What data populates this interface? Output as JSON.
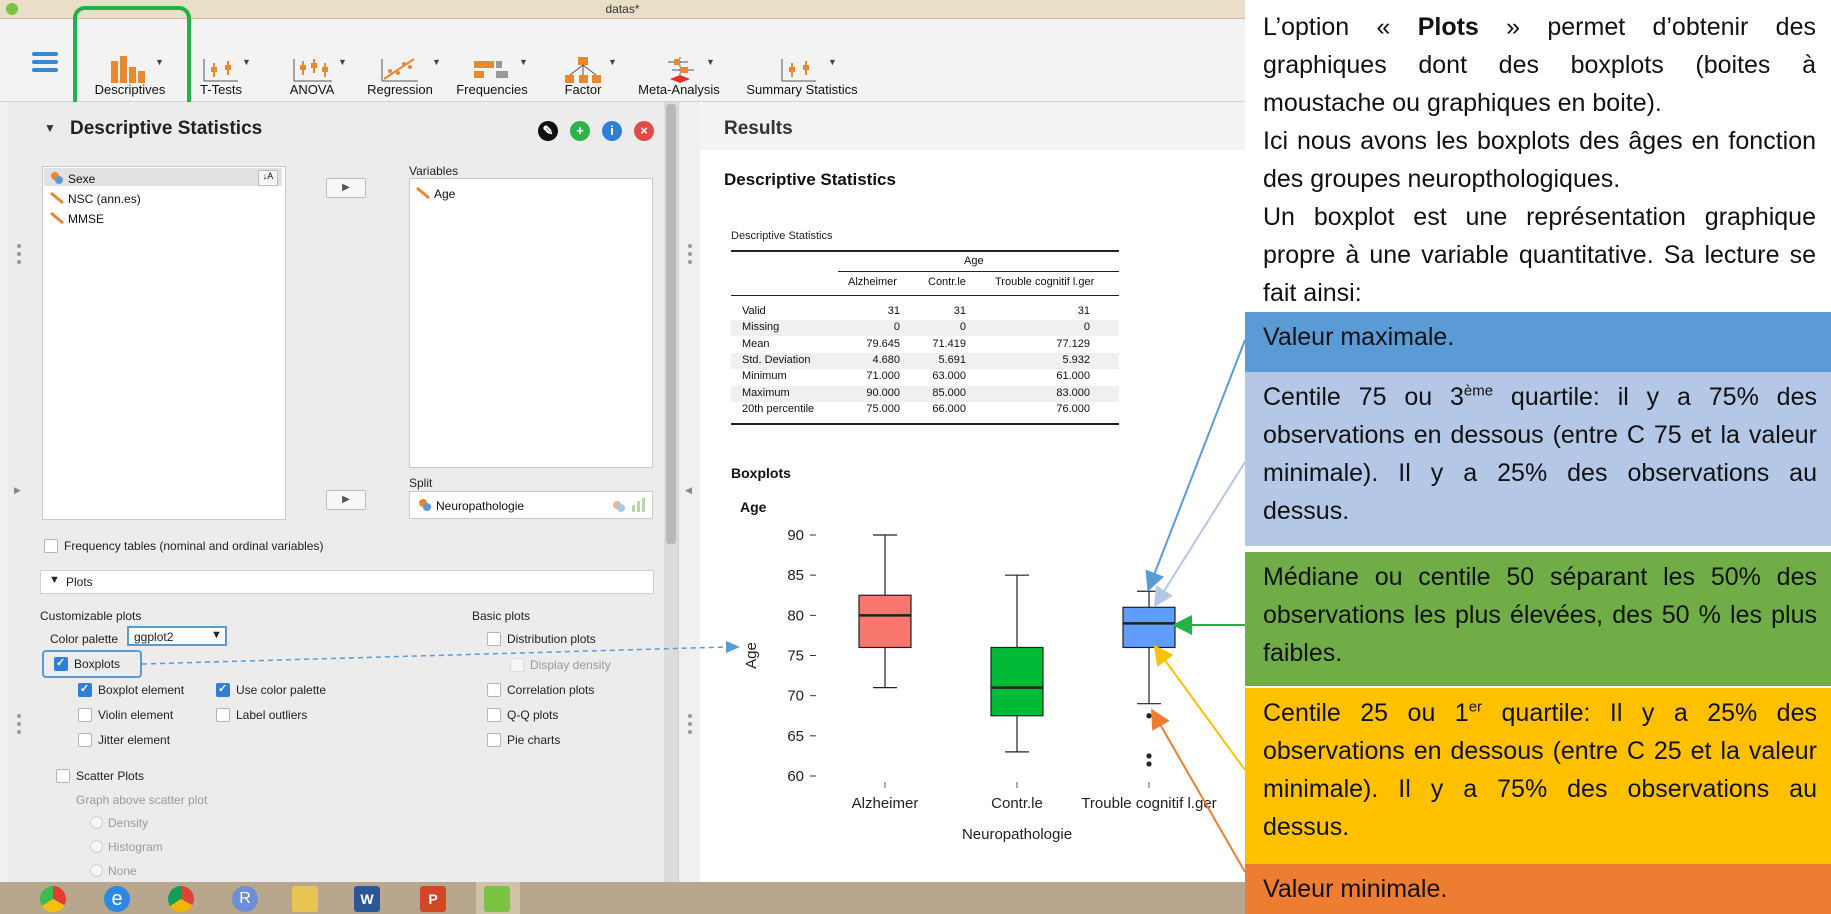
{
  "window": {
    "title": "datas*"
  },
  "ribbon": {
    "items": [
      {
        "label": "Descriptives",
        "icon": "bar-chart-icon"
      },
      {
        "label": "T-Tests",
        "icon": "ttest-icon"
      },
      {
        "label": "ANOVA",
        "icon": "anova-icon"
      },
      {
        "label": "Regression",
        "icon": "regression-icon"
      },
      {
        "label": "Frequencies",
        "icon": "frequencies-icon"
      },
      {
        "label": "Factor",
        "icon": "factor-icon"
      },
      {
        "label": "Meta-Analysis",
        "icon": "meta-analysis-icon"
      },
      {
        "label": "Summary Statistics",
        "icon": "summary-statistics-icon"
      }
    ]
  },
  "analysis_panel": {
    "title": "Descriptive Statistics",
    "available_vars": [
      "Sexe",
      "NSC (ann.es)",
      "MMSE"
    ],
    "variables_label": "Variables",
    "variables": [
      "Age"
    ],
    "split_label": "Split",
    "split_var": "Neuropathologie",
    "frequency_tables_label": "Frequency tables (nominal and ordinal variables)",
    "plots_section": "Plots",
    "customizable_label": "Customizable plots",
    "color_palette_label": "Color palette",
    "color_palette_value": "ggplot2",
    "boxplots_label": "Boxplots",
    "boxplot_element_label": "Boxplot element",
    "use_color_palette_label": "Use color palette",
    "violin_label": "Violin element",
    "label_outliers_label": "Label outliers",
    "jitter_label": "Jitter element",
    "scatter_label": "Scatter Plots",
    "graph_above_label": "Graph above scatter plot",
    "density_label": "Density",
    "histogram_label": "Histogram",
    "none_label": "None",
    "basic_plots_label": "Basic plots",
    "distribution_label": "Distribution plots",
    "display_density_label": "Display density",
    "correlation_label": "Correlation plots",
    "qq_label": "Q-Q plots",
    "pie_label": "Pie charts"
  },
  "results": {
    "title": "Results",
    "section": "Descriptive Statistics",
    "table_caption": "Descriptive Statistics",
    "group_header": "Age",
    "columns": [
      "Alzheimer",
      "Contr.le",
      "Trouble cognitif l.ger"
    ],
    "rows": [
      {
        "label": "Valid",
        "values": [
          "31",
          "31",
          "31"
        ]
      },
      {
        "label": "Missing",
        "values": [
          "0",
          "0",
          "0"
        ]
      },
      {
        "label": "Mean",
        "values": [
          "79.645",
          "71.419",
          "77.129"
        ]
      },
      {
        "label": "Std. Deviation",
        "values": [
          "4.680",
          "5.691",
          "5.932"
        ]
      },
      {
        "label": "Minimum",
        "values": [
          "71.000",
          "63.000",
          "61.000"
        ]
      },
      {
        "label": "Maximum",
        "values": [
          "90.000",
          "85.000",
          "83.000"
        ]
      },
      {
        "label": "20th percentile",
        "values": [
          "75.000",
          "66.000",
          "76.000"
        ]
      }
    ],
    "boxplots_title": "Boxplots"
  },
  "chart_data": {
    "type": "boxplot",
    "title": "Age",
    "xlabel": "Neuropathologie",
    "ylabel": "Age",
    "ylim": [
      60,
      90
    ],
    "yticks": [
      60,
      65,
      70,
      75,
      80,
      85,
      90
    ],
    "categories": [
      "Alzheimer",
      "Contr.le",
      "Trouble cognitif l.ger"
    ],
    "colors": [
      "#f8766d",
      "#00ba38",
      "#619cff"
    ],
    "boxes": [
      {
        "min": 71,
        "q1": 76,
        "median": 80,
        "q3": 82.5,
        "max": 90,
        "outliers": []
      },
      {
        "min": 63,
        "q1": 67.5,
        "median": 71,
        "q3": 76,
        "max": 85,
        "outliers": []
      },
      {
        "min": 69,
        "q1": 76,
        "median": 79,
        "q3": 81,
        "max": 83,
        "outliers": [
          67.5,
          61.5,
          62.5
        ]
      }
    ]
  },
  "annotation": {
    "intro_parts": {
      "before": "L’option « ",
      "bold": "Plots",
      "after": " » permet d’obtenir des graphiques dont des boxplots (boites à moustache ou graphiques en boite)."
    },
    "line2": "Ici nous avons les boxplots des âges en fonction des groupes neuropthologiques.",
    "line3": "Un boxplot est une représentation graphique propre à une variable quantitative. Sa lecture se fait ainsi:",
    "boxes": [
      {
        "text": "Valeur maximale.",
        "color": "#5b9bd5"
      },
      {
        "pre": "Centile 75 ou 3",
        "sup": "ème",
        "post": " quartile: il y a 75% des observations en dessous (entre C 75 et la valeur minimale). Il y a 25% des observations au dessus.",
        "color": "#b4c7e7"
      },
      {
        "text": "Médiane ou centile 50 séparant les 50% des observations les plus élevées, des 50 % les plus faibles.",
        "color": "#70ad47"
      },
      {
        "pre": "Centile 25 ou 1",
        "sup": "er",
        "post": " quartile: Il y a 25% des observations en dessous (entre C 25 et la valeur minimale). Il y a 75% des observations au dessus.",
        "color": "#ffc000"
      },
      {
        "text": "Valeur minimale.",
        "color": "#ed7d31"
      }
    ]
  },
  "taskbar": {
    "apps": [
      "chrome-like-icon",
      "internet-explorer-icon",
      "chrome-icon",
      "r-icon",
      "file-explorer-icon",
      "word-icon",
      "powerpoint-icon",
      "jasp-icon"
    ]
  }
}
